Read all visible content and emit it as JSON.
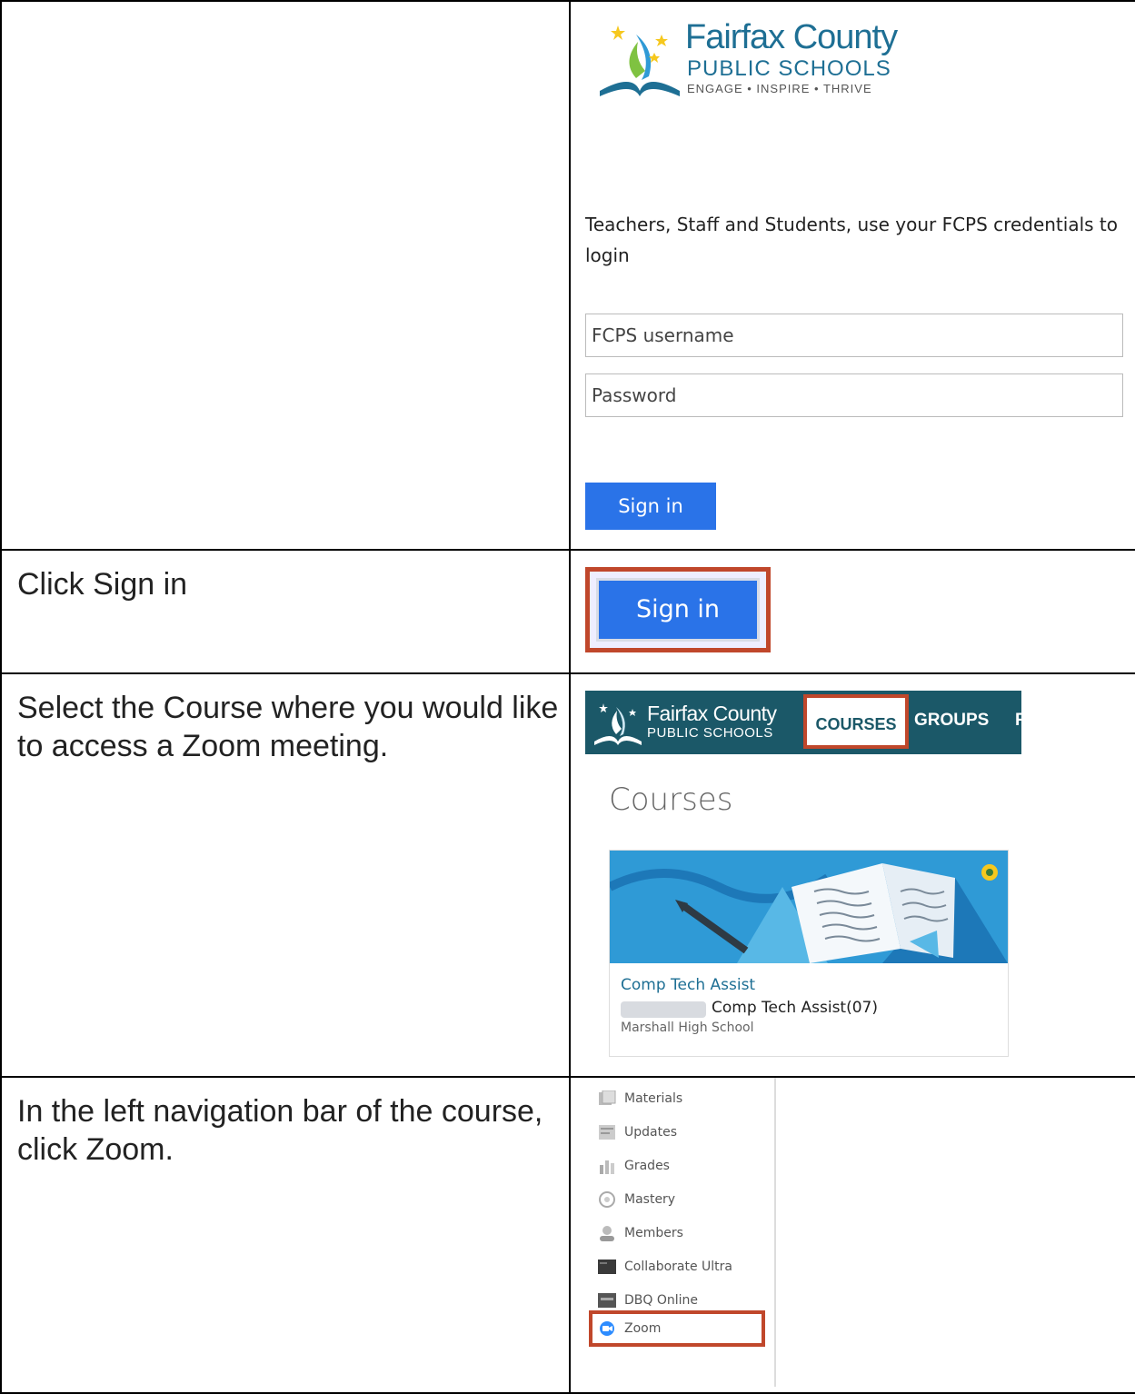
{
  "steps": [
    {
      "instruction": ""
    },
    {
      "instruction": "Click Sign in"
    },
    {
      "instruction": "Select the Course where you would like to access a Zoom meeting."
    },
    {
      "instruction": "In the left navigation bar of the course, click Zoom."
    }
  ],
  "login": {
    "logo_title": "Fairfax County",
    "logo_subtitle": "PUBLIC SCHOOLS",
    "logo_tagline": "ENGAGE • INSPIRE • THRIVE",
    "intro": "Teachers, Staff and Students, use your FCPS credentials to login",
    "username_placeholder": "FCPS username",
    "password_placeholder": "Password",
    "signin_label": "Sign in"
  },
  "signin_highlight": {
    "label": "Sign in"
  },
  "courses_page": {
    "logo_title": "Fairfax County",
    "logo_subtitle": "PUBLIC SCHOOLS",
    "nav": [
      "COURSES",
      "GROUPS",
      "F"
    ],
    "heading": "Courses",
    "card": {
      "title": "Comp Tech Assist",
      "section": "Comp Tech Assist(07)",
      "school": "Marshall High School"
    }
  },
  "course_nav": {
    "items": [
      {
        "label": "Materials",
        "icon": "materials-icon"
      },
      {
        "label": "Updates",
        "icon": "updates-icon"
      },
      {
        "label": "Grades",
        "icon": "grades-icon"
      },
      {
        "label": "Mastery",
        "icon": "mastery-icon"
      },
      {
        "label": "Members",
        "icon": "members-icon"
      },
      {
        "label": "Collaborate Ultra",
        "icon": "collaborate-icon"
      },
      {
        "label": "DBQ Online",
        "icon": "dbq-icon"
      },
      {
        "label": "Zoom",
        "icon": "zoom-icon"
      }
    ]
  },
  "colors": {
    "highlight": "#c0472b",
    "primary_button": "#2a73e8",
    "nav_bar": "#1b5868",
    "brand_text": "#1e6f94"
  }
}
